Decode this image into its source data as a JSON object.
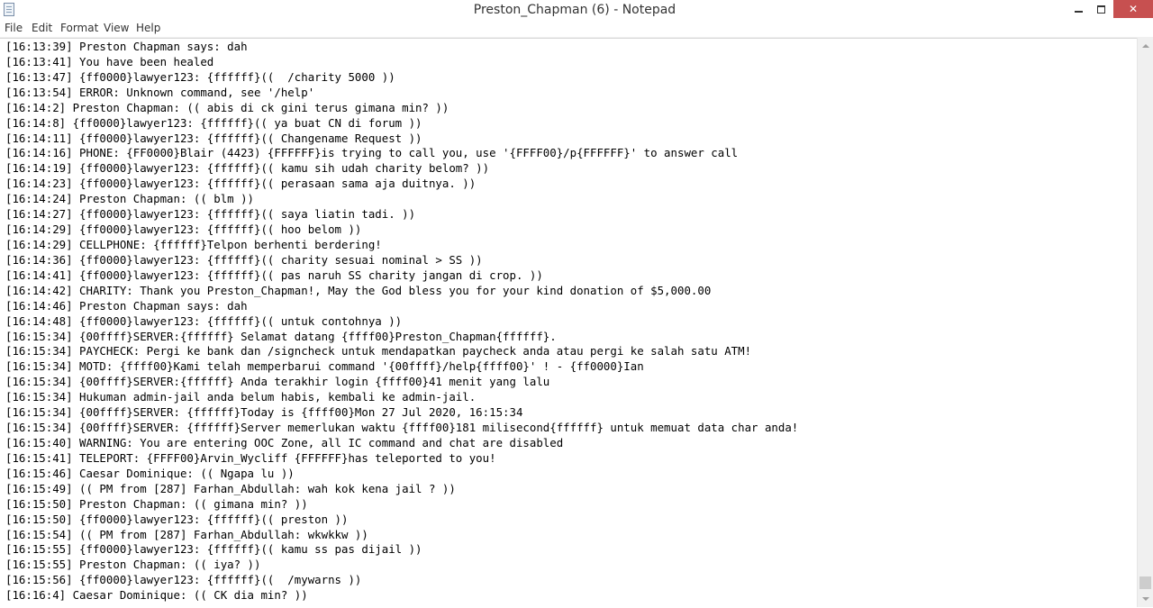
{
  "window": {
    "title": "Preston_Chapman (6) - Notepad",
    "icon": "notepad-icon"
  },
  "menu": [
    "File",
    "Edit",
    "Format",
    "View",
    "Help"
  ],
  "editor": {
    "lines": [
      "[16:13:39] Preston Chapman says: dah",
      "[16:13:41] You have been healed",
      "[16:13:47] {ff0000}lawyer123: {ffffff}((  /charity 5000 ))",
      "[16:13:54] ERROR: Unknown command, see '/help'",
      "[16:14:2] Preston Chapman: (( abis di ck gini terus gimana min? ))",
      "[16:14:8] {ff0000}lawyer123: {ffffff}(( ya buat CN di forum ))",
      "[16:14:11] {ff0000}lawyer123: {ffffff}(( Changename Request ))",
      "[16:14:16] PHONE: {FF0000}Blair (4423) {FFFFFF}is trying to call you, use '{FFFF00}/p{FFFFFF}' to answer call",
      "[16:14:19] {ff0000}lawyer123: {ffffff}(( kamu sih udah charity belom? ))",
      "[16:14:23] {ff0000}lawyer123: {ffffff}(( perasaan sama aja duitnya. ))",
      "[16:14:24] Preston Chapman: (( blm ))",
      "[16:14:27] {ff0000}lawyer123: {ffffff}(( saya liatin tadi. ))",
      "[16:14:29] {ff0000}lawyer123: {ffffff}(( hoo belom ))",
      "[16:14:29] CELLPHONE: {ffffff}Telpon berhenti berdering!",
      "[16:14:36] {ff0000}lawyer123: {ffffff}(( charity sesuai nominal > SS ))",
      "[16:14:41] {ff0000}lawyer123: {ffffff}(( pas naruh SS charity jangan di crop. ))",
      "[16:14:42] CHARITY: Thank you Preston_Chapman!, May the God bless you for your kind donation of $5,000.00",
      "[16:14:46] Preston Chapman says: dah",
      "[16:14:48] {ff0000}lawyer123: {ffffff}(( untuk contohnya ))",
      "[16:15:34] {00ffff}SERVER:{ffffff} Selamat datang {ffff00}Preston_Chapman{ffffff}.",
      "[16:15:34] PAYCHECK: Pergi ke bank dan /signcheck untuk mendapatkan paycheck anda atau pergi ke salah satu ATM!",
      "[16:15:34] MOTD: {ffff00}Kami telah memperbarui command '{00ffff}/help{ffff00}' ! - {ff0000}Ian",
      "[16:15:34] {00ffff}SERVER:{ffffff} Anda terakhir login {ffff00}41 menit yang lalu",
      "[16:15:34] Hukuman admin-jail anda belum habis, kembali ke admin-jail.",
      "[16:15:34] {00ffff}SERVER: {ffffff}Today is {ffff00}Mon 27 Jul 2020, 16:15:34",
      "[16:15:34] {00ffff}SERVER: {ffffff}Server memerlukan waktu {ffff00}181 milisecond{ffffff} untuk memuat data char anda!",
      "[16:15:40] WARNING: You are entering OOC Zone, all IC command and chat are disabled",
      "[16:15:41] TELEPORT: {FFFF00}Arvin_Wycliff {FFFFFF}has teleported to you!",
      "[16:15:46] Caesar Dominique: (( Ngapa lu ))",
      "[16:15:49] (( PM from [287] Farhan_Abdullah: wah kok kena jail ? ))",
      "[16:15:50] Preston Chapman: (( gimana min? ))",
      "[16:15:50] {ff0000}lawyer123: {ffffff}(( preston ))",
      "[16:15:54] (( PM from [287] Farhan_Abdullah: wkwkkw ))",
      "[16:15:55] {ff0000}lawyer123: {ffffff}(( kamu ss pas dijail ))",
      "[16:15:55] Preston Chapman: (( iya? ))",
      "[16:15:56] {ff0000}lawyer123: {ffffff}((  /mywarns ))",
      "[16:16:4] Caesar Dominique: (( CK dia min? ))"
    ]
  }
}
